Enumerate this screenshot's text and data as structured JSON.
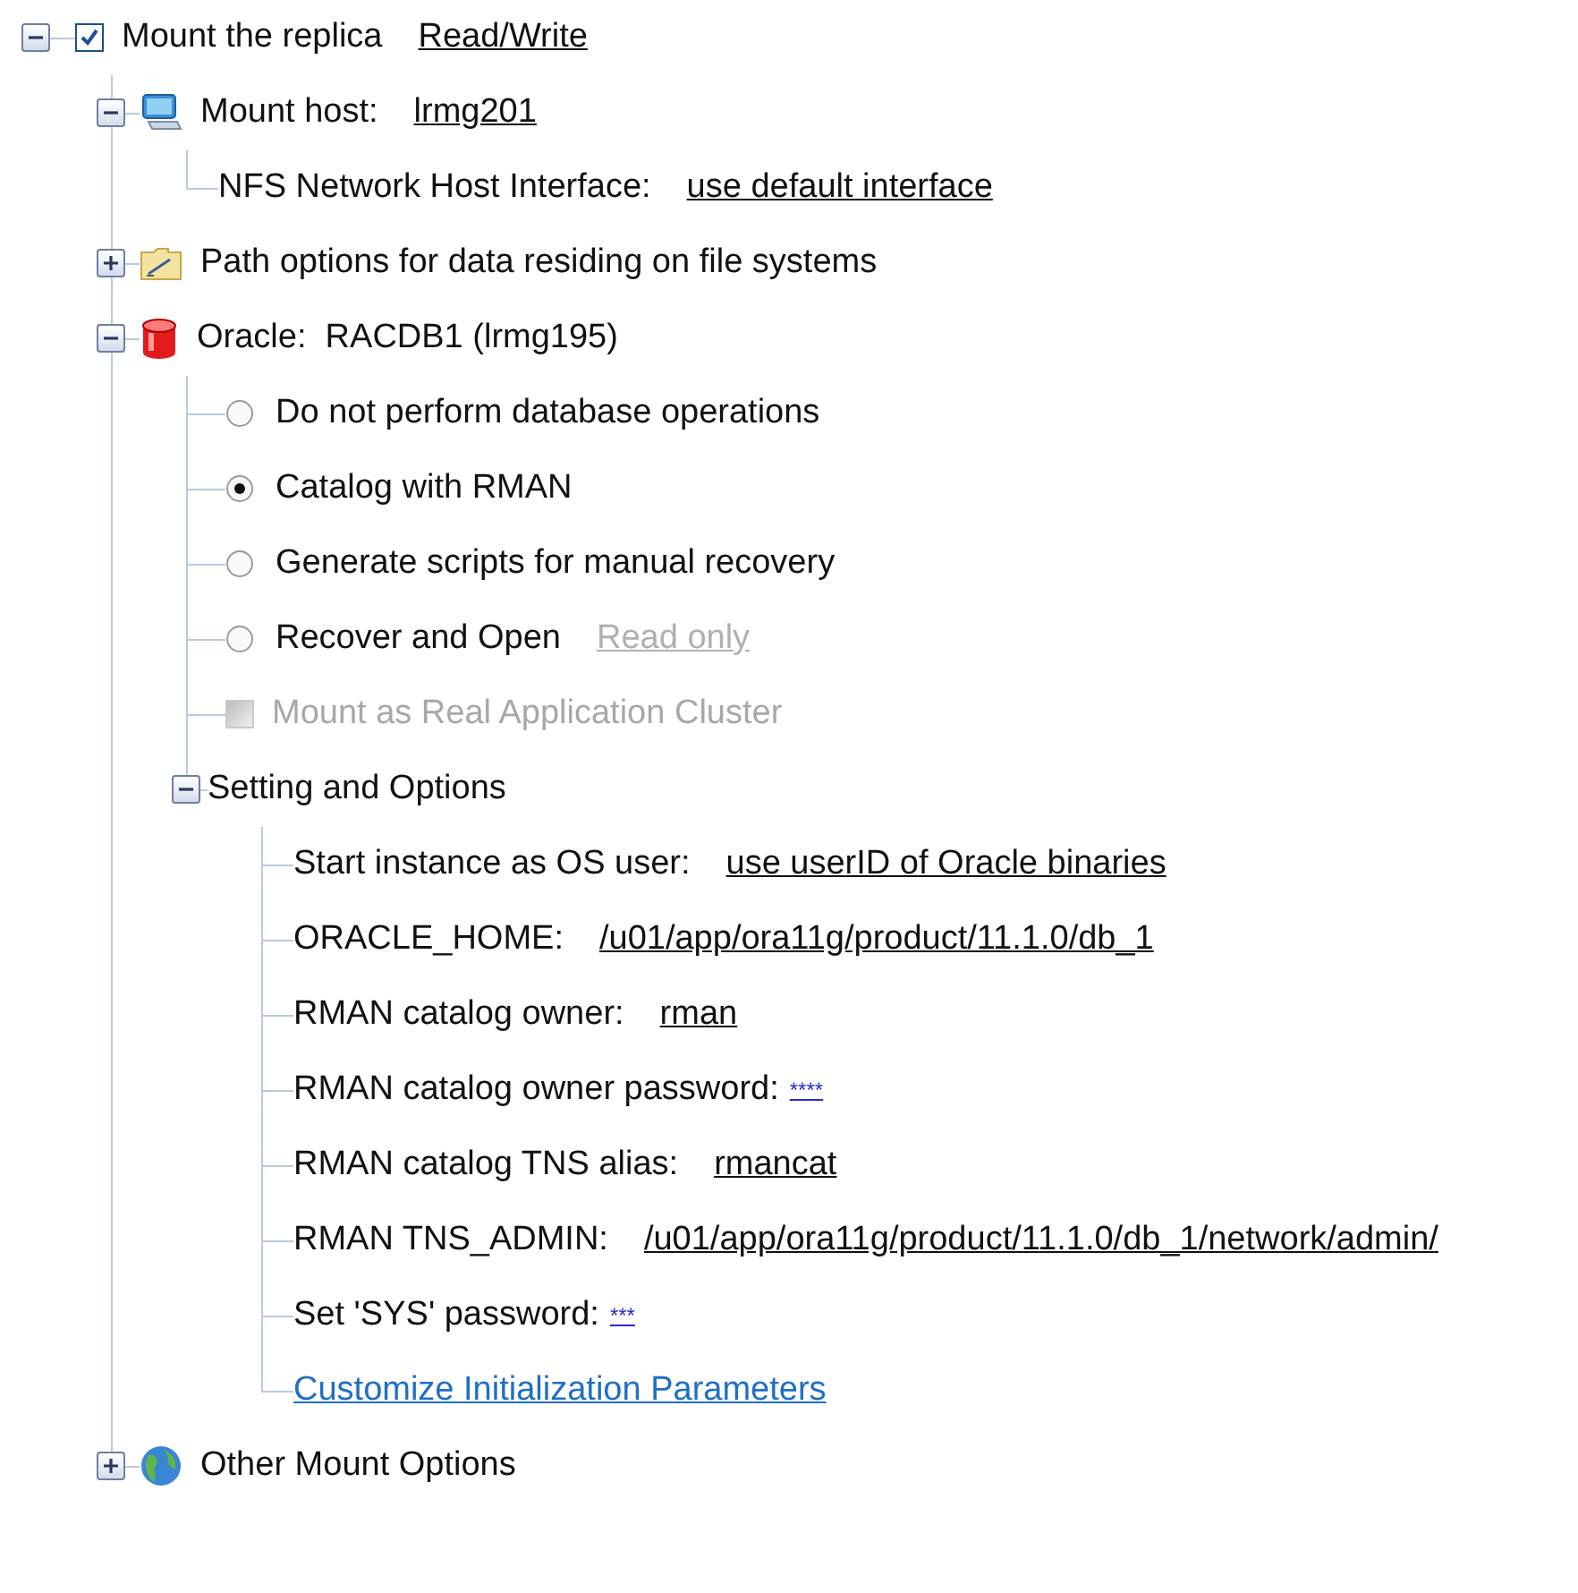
{
  "tree": [
    {
      "kind": "check",
      "label": "Mount the replica",
      "checked": true,
      "disabled": false,
      "expanded": true,
      "value": {
        "text": "Read/Write",
        "kind": "link"
      },
      "children": [
        {
          "kind": "host",
          "label": "Mount host:",
          "value": {
            "text": "lrmg201",
            "kind": "link"
          },
          "expanded": true,
          "children": [
            {
              "kind": "setting",
              "label": "NFS Network Host Interface:",
              "value": {
                "text": "use default interface",
                "kind": "link"
              }
            }
          ]
        },
        {
          "kind": "paths",
          "label": "Path options for data residing on file systems",
          "expanded": false
        },
        {
          "kind": "database",
          "label": "Oracle:  RACDB1 (lrmg195)",
          "expanded": true,
          "children": [
            {
              "kind": "radio",
              "label": "Do not perform database operations",
              "selected": false
            },
            {
              "kind": "radio",
              "label": "Catalog with RMAN",
              "selected": true
            },
            {
              "kind": "radio",
              "label": "Generate scripts for manual recovery",
              "selected": false
            },
            {
              "kind": "radio",
              "label": "Recover and Open",
              "selected": false,
              "value": {
                "text": "Read only",
                "kind": "link",
                "disabled": true
              }
            },
            {
              "kind": "check",
              "label": "Mount as Real Application Cluster",
              "checked": false,
              "disabled": true
            },
            {
              "kind": "group",
              "label": "Setting and Options",
              "expanded": true,
              "children": [
                {
                  "kind": "setting",
                  "label": "Start instance as OS user:",
                  "value": {
                    "text": "use userID of Oracle binaries",
                    "kind": "link"
                  }
                },
                {
                  "kind": "setting",
                  "label": "ORACLE_HOME:",
                  "value": {
                    "text": "/u01/app/ora11g/product/11.1.0/db_1",
                    "kind": "link"
                  }
                },
                {
                  "kind": "setting",
                  "label": "RMAN catalog owner:",
                  "value": {
                    "text": "rman",
                    "kind": "link"
                  }
                },
                {
                  "kind": "setting",
                  "label": "RMAN catalog owner password:",
                  "value": {
                    "text": "****",
                    "kind": "secret"
                  }
                },
                {
                  "kind": "setting",
                  "label": "RMAN catalog TNS alias:",
                  "value": {
                    "text": "rmancat",
                    "kind": "link"
                  }
                },
                {
                  "kind": "setting",
                  "label": "RMAN TNS_ADMIN:",
                  "value": {
                    "text": "/u01/app/ora11g/product/11.1.0/db_1/network/admin/",
                    "kind": "link"
                  }
                },
                {
                  "kind": "setting",
                  "label": "Set 'SYS' password:",
                  "value": {
                    "text": "***",
                    "kind": "secret"
                  }
                },
                {
                  "kind": "link",
                  "label": "Customize Initialization Parameters"
                }
              ]
            }
          ]
        },
        {
          "kind": "options",
          "label": "Other Mount Options",
          "expanded": false
        }
      ]
    }
  ]
}
